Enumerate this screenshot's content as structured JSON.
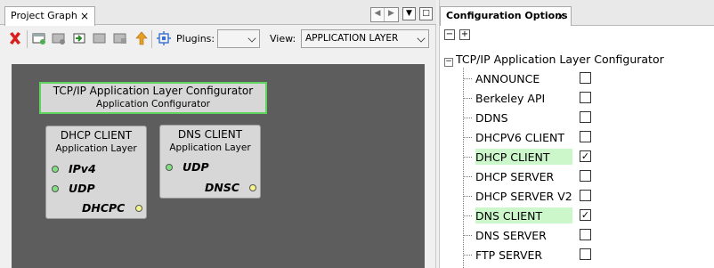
{
  "project_graph": {
    "tab_title": "Project Graph",
    "tab_close": "×",
    "window_controls": {
      "prev": "◀",
      "next": "▶",
      "menu": "▼",
      "restore": "□"
    },
    "toolbar": {
      "plugins_label": "Plugins:",
      "plugins_value": "",
      "view_label": "View:",
      "view_value": "APPLICATION LAYER"
    },
    "app_configurator": {
      "title": "TCP/IP Application Layer Configurator",
      "subtitle": "Application Configurator"
    },
    "nodes": [
      {
        "title": "DHCP CLIENT",
        "subtitle": "Application Layer",
        "ports": [
          "IPv4",
          "UDP",
          "DHCPC"
        ]
      },
      {
        "title": "DNS CLIENT",
        "subtitle": "Application Layer",
        "ports": [
          "UDP",
          "DNSC"
        ]
      }
    ]
  },
  "config_options": {
    "tab_title": "Configuration Options",
    "tab_close": "×",
    "collapse_all": "−",
    "expand_all": "+",
    "root": "TCP/IP Application Layer Configurator",
    "items": [
      {
        "label": "ANNOUNCE",
        "checked": ""
      },
      {
        "label": "Berkeley API",
        "checked": ""
      },
      {
        "label": "DDNS",
        "checked": ""
      },
      {
        "label": "DHCPV6 CLIENT",
        "checked": ""
      },
      {
        "label": "DHCP CLIENT",
        "checked": "✓"
      },
      {
        "label": "DHCP SERVER",
        "checked": ""
      },
      {
        "label": "DHCP SERVER V2",
        "checked": ""
      },
      {
        "label": "DNS CLIENT",
        "checked": "✓"
      },
      {
        "label": "DNS SERVER",
        "checked": ""
      },
      {
        "label": "FTP SERVER",
        "checked": ""
      }
    ]
  },
  "colors": {
    "canvas": "#5d5d5d",
    "highlight": "#cbf7cb",
    "selection_border": "#5fd45f",
    "port_dot_input": "#7fe07f",
    "port_dot_output": "#f5f58a",
    "delete_icon": "#d8201c",
    "up_arrow_icon": "#e8a020"
  }
}
